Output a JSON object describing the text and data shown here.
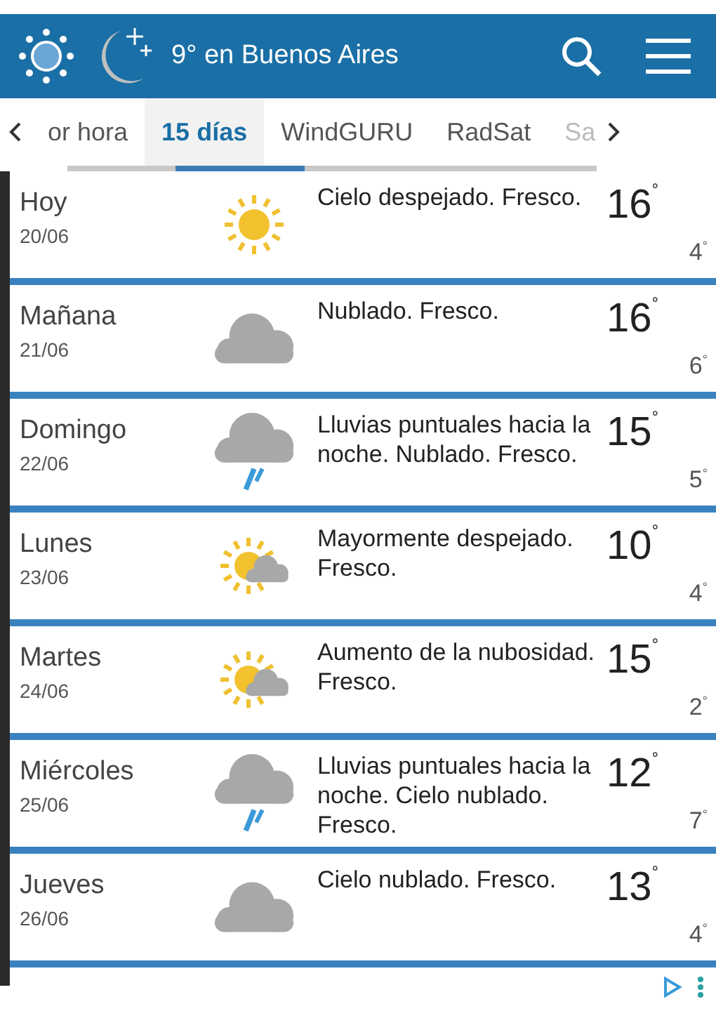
{
  "header": {
    "title": "9° en Buenos Aires"
  },
  "tabs": [
    {
      "label": "or hora",
      "selected": false
    },
    {
      "label": "15 días",
      "selected": true
    },
    {
      "label": "WindGURU",
      "selected": false
    },
    {
      "label": "RadSat",
      "selected": false
    },
    {
      "label": "Sa",
      "selected": false
    }
  ],
  "days": [
    {
      "day": "Hoy",
      "date": "20/06",
      "kind": "sun",
      "description": "Cielo despejado. Fresco.",
      "max": "16$^{°}$",
      "min": "4$^{°}$"
    },
    {
      "day": "Mañana",
      "date": "21/06",
      "kind": "cloud",
      "description": "Nublado. Fresco.",
      "max": "16$^{°}$",
      "min": "6$^{°}$"
    },
    {
      "day": "Domingo",
      "date": "22/06",
      "kind": "rain",
      "description": "Lluvias puntuales hacia la noche. Nublado. Fresco.",
      "max": "15$^{°}$",
      "min": "5$^{°}$"
    },
    {
      "day": "Lunes",
      "date": "23/06",
      "kind": "suncloud",
      "description": "Mayormente despejado. Fresco.",
      "max": "10$^{°}$",
      "min": "4$^{°}$"
    },
    {
      "day": "Martes",
      "date": "24/06",
      "kind": "suncloud",
      "description": "Aumento de la nubosidad. Fresco.",
      "max": "15$^{°}$",
      "min": "2$^{°}$"
    },
    {
      "day": "Miércoles",
      "date": "25/06",
      "kind": "rain",
      "description": "Lluvias puntuales hacia la noche. Cielo nublado. Fresco.",
      "max": "12$^{°}$",
      "min": "7$^{°}$"
    },
    {
      "day": "Jueves",
      "date": "26/06",
      "kind": "cloud",
      "description": "Cielo nublado. Fresco.",
      "max": "13$^{°}$",
      "min": "4$^{°}$"
    }
  ]
}
